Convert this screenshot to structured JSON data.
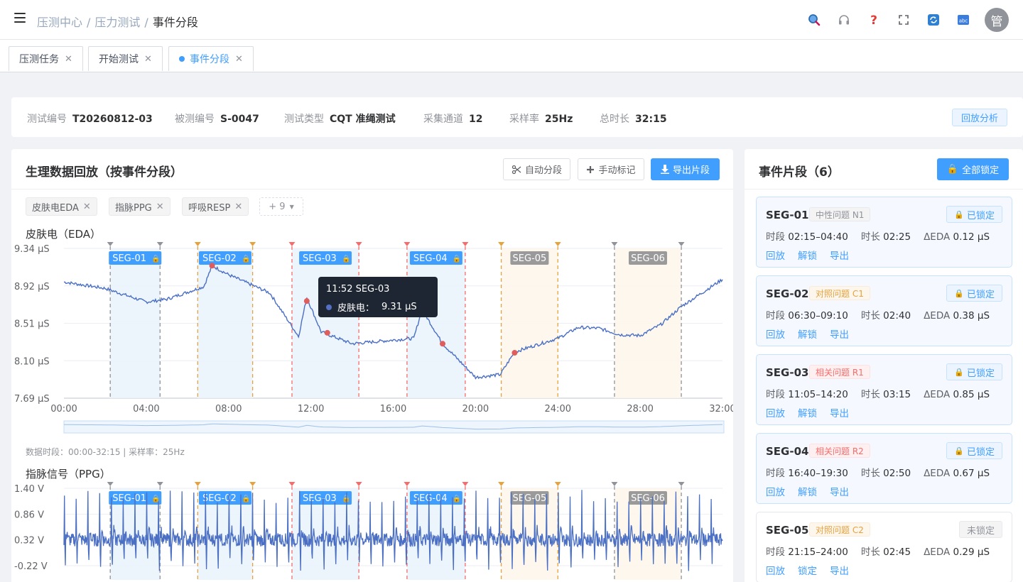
{
  "header": {
    "breadcrumbs": [
      "压测中心",
      "压力测试",
      "事件分段"
    ],
    "avatar_text": "管",
    "icons": [
      "search-icon",
      "headset-icon",
      "help-icon",
      "fullscreen-icon",
      "refresh-icon",
      "language-icon"
    ]
  },
  "tabs": [
    {
      "label": "压测任务",
      "active": false
    },
    {
      "label": "开始测试",
      "active": false
    },
    {
      "label": "事件分段",
      "active": true
    }
  ],
  "info": {
    "items": [
      {
        "key": "测试编号",
        "value": "T20260812-03"
      },
      {
        "key": "被测编号",
        "value": "S-0047"
      },
      {
        "key": "测试类型",
        "value": "CQT 准绳测试"
      },
      {
        "key": "采集通道",
        "value": "12"
      },
      {
        "key": "采样率",
        "value": "25Hz"
      },
      {
        "key": "总时长",
        "value": "32:15"
      }
    ],
    "replay_label": "回放分析"
  },
  "main": {
    "title": "生理数据回放（按事件分段）",
    "auto_seg_label": "自动分段",
    "manual_mark_label": "手动标记",
    "export_label": "导出片段",
    "chips": [
      "皮肤电EDA",
      "指脉PPG",
      "呼吸RESP"
    ],
    "chips_more": "+ 9",
    "eda_label": "皮肤电（EDA）",
    "ppg_label": "指脉信号（PPG）",
    "note": "数据时段：00:00-32:15 | 采样率：25Hz",
    "tooltip": {
      "title": "11:52  SEG-03",
      "series": "皮肤电：",
      "value": "9.31 μS"
    }
  },
  "chart_data": [
    {
      "type": "line",
      "name": "皮肤电（EDA）",
      "ylim": [
        7.69,
        9.34
      ],
      "yticks": [
        "9.34 μS",
        "8.92 μS",
        "8.51 μS",
        "8.10 μS",
        "7.69 μS"
      ],
      "xlim": [
        "00:00",
        "32:00"
      ],
      "xticks": [
        "00:00",
        "04:00",
        "08:00",
        "12:00",
        "16:00",
        "20:00",
        "24:00",
        "28:00",
        "32:00"
      ],
      "x_minutes": [
        0,
        2,
        4,
        5,
        6.8,
        7.2,
        8,
        10,
        11.4,
        11.8,
        12.5,
        14,
        16,
        17,
        17.4,
        18.4,
        20,
        21.2,
        21.9,
        24,
        25,
        26,
        27,
        28,
        29,
        30,
        32
      ],
      "y": [
        8.97,
        8.9,
        8.75,
        8.78,
        8.92,
        9.15,
        9.05,
        8.85,
        8.37,
        8.8,
        8.42,
        8.29,
        8.33,
        8.35,
        8.67,
        8.29,
        7.92,
        7.95,
        8.2,
        8.35,
        8.47,
        8.46,
        8.39,
        8.38,
        8.5,
        8.7,
        9.0
      ],
      "markers": [
        {
          "x": 7.2,
          "y": 9.15
        },
        {
          "x": 11.8,
          "y": 8.76
        },
        {
          "x": 12.8,
          "y": 8.41
        },
        {
          "x": 18.4,
          "y": 8.29
        },
        {
          "x": 21.9,
          "y": 8.19
        }
      ]
    },
    {
      "type": "line",
      "name": "指脉信号（PPG）",
      "ylim": [
        -0.22,
        1.4
      ],
      "yticks": [
        "1.40 V",
        "0.86 V",
        "0.32 V",
        "-0.22 V"
      ],
      "beat_count": 56,
      "baseline": 0.32,
      "peak": 1.25,
      "trough": -0.2
    }
  ],
  "segments": [
    {
      "id": "SEG-01",
      "start": 2.25,
      "end": 4.67,
      "locked": true,
      "color": "#909399",
      "fill": "#eaf3fc"
    },
    {
      "id": "SEG-02",
      "start": 6.5,
      "end": 9.17,
      "locked": true,
      "color": "#e6a23c",
      "fill": "#eaf3fc"
    },
    {
      "id": "SEG-03",
      "start": 11.08,
      "end": 14.33,
      "locked": true,
      "color": "#f56c6c",
      "fill": "#eaf3fc"
    },
    {
      "id": "SEG-04",
      "start": 16.67,
      "end": 19.5,
      "locked": true,
      "color": "#f56c6c",
      "fill": "#eaf3fc"
    },
    {
      "id": "SEG-05",
      "start": 21.25,
      "end": 24.0,
      "locked": false,
      "color": "#e6a23c",
      "fill": "#fdf6ec"
    },
    {
      "id": "SEG-06",
      "start": 26.75,
      "end": 30.0,
      "locked": false,
      "color": "#909399",
      "fill": "#fdf6ec"
    }
  ],
  "side": {
    "title": "事件片段（6）",
    "lock_all_label": "全部锁定",
    "cards": [
      {
        "id": "SEG-01",
        "tag": "中性问题 N1",
        "tag_style": "gray",
        "status": "已锁定",
        "locked": true,
        "period_k": "时段",
        "period": "02:15–04:40",
        "dur_k": "时长",
        "dur": "02:25",
        "eda_k": "ΔEDA",
        "eda": "0.12 μS",
        "acts": [
          "回放",
          "解锁",
          "导出"
        ]
      },
      {
        "id": "SEG-02",
        "tag": "对照问题 C1",
        "tag_style": "orange",
        "status": "已锁定",
        "locked": true,
        "period_k": "时段",
        "period": "06:30–09:10",
        "dur_k": "时长",
        "dur": "02:40",
        "eda_k": "ΔEDA",
        "eda": "0.38 μS",
        "acts": [
          "回放",
          "解锁",
          "导出"
        ]
      },
      {
        "id": "SEG-03",
        "tag": "相关问题 R1",
        "tag_style": "red",
        "status": "已锁定",
        "locked": true,
        "period_k": "时段",
        "period": "11:05–14:20",
        "dur_k": "时长",
        "dur": "03:15",
        "eda_k": "ΔEDA",
        "eda": "0.85 μS",
        "acts": [
          "回放",
          "解锁",
          "导出"
        ]
      },
      {
        "id": "SEG-04",
        "tag": "相关问题 R2",
        "tag_style": "red",
        "status": "已锁定",
        "locked": true,
        "period_k": "时段",
        "period": "16:40–19:30",
        "dur_k": "时长",
        "dur": "02:50",
        "eda_k": "ΔEDA",
        "eda": "0.67 μS",
        "acts": [
          "回放",
          "解锁",
          "导出"
        ]
      },
      {
        "id": "SEG-05",
        "tag": "对照问题 C2",
        "tag_style": "orange",
        "status": "未锁定",
        "locked": false,
        "period_k": "时段",
        "period": "21:15–24:00",
        "dur_k": "时长",
        "dur": "02:45",
        "eda_k": "ΔEDA",
        "eda": "0.29 μS",
        "acts": [
          "回放",
          "锁定",
          "导出"
        ]
      }
    ]
  }
}
